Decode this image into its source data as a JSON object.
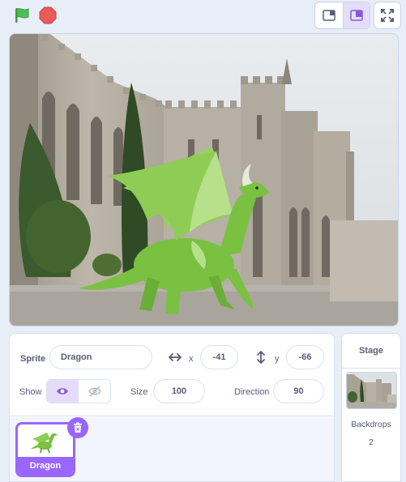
{
  "toolbar": {
    "green_flag_icon": "green-flag-icon",
    "stop_icon": "stop-sign-icon",
    "small_stage_icon": "small-stage-layout-icon",
    "normal_stage_icon": "normal-stage-layout-icon",
    "fullscreen_icon": "fullscreen-icon"
  },
  "stage": {
    "backdrop": "palace-castle-backdrop",
    "sprite": "dragon"
  },
  "sprite_info": {
    "sprite_label": "Sprite",
    "sprite_name": "Dragon",
    "x_label": "x",
    "x_value": "-41",
    "y_label": "y",
    "y_value": "-66",
    "show_label": "Show",
    "size_label": "Size",
    "size_value": "100",
    "direction_label": "Direction",
    "direction_value": "90"
  },
  "sprites": [
    {
      "name": "Dragon",
      "selected": true
    }
  ],
  "stage_panel": {
    "title": "Stage",
    "backdrops_label": "Backdrops",
    "backdrops_count": "2"
  },
  "colors": {
    "accent": "#9966ff",
    "flag": "#4cbf56",
    "stop": "#ec5959",
    "dragon": "#7ac142"
  }
}
